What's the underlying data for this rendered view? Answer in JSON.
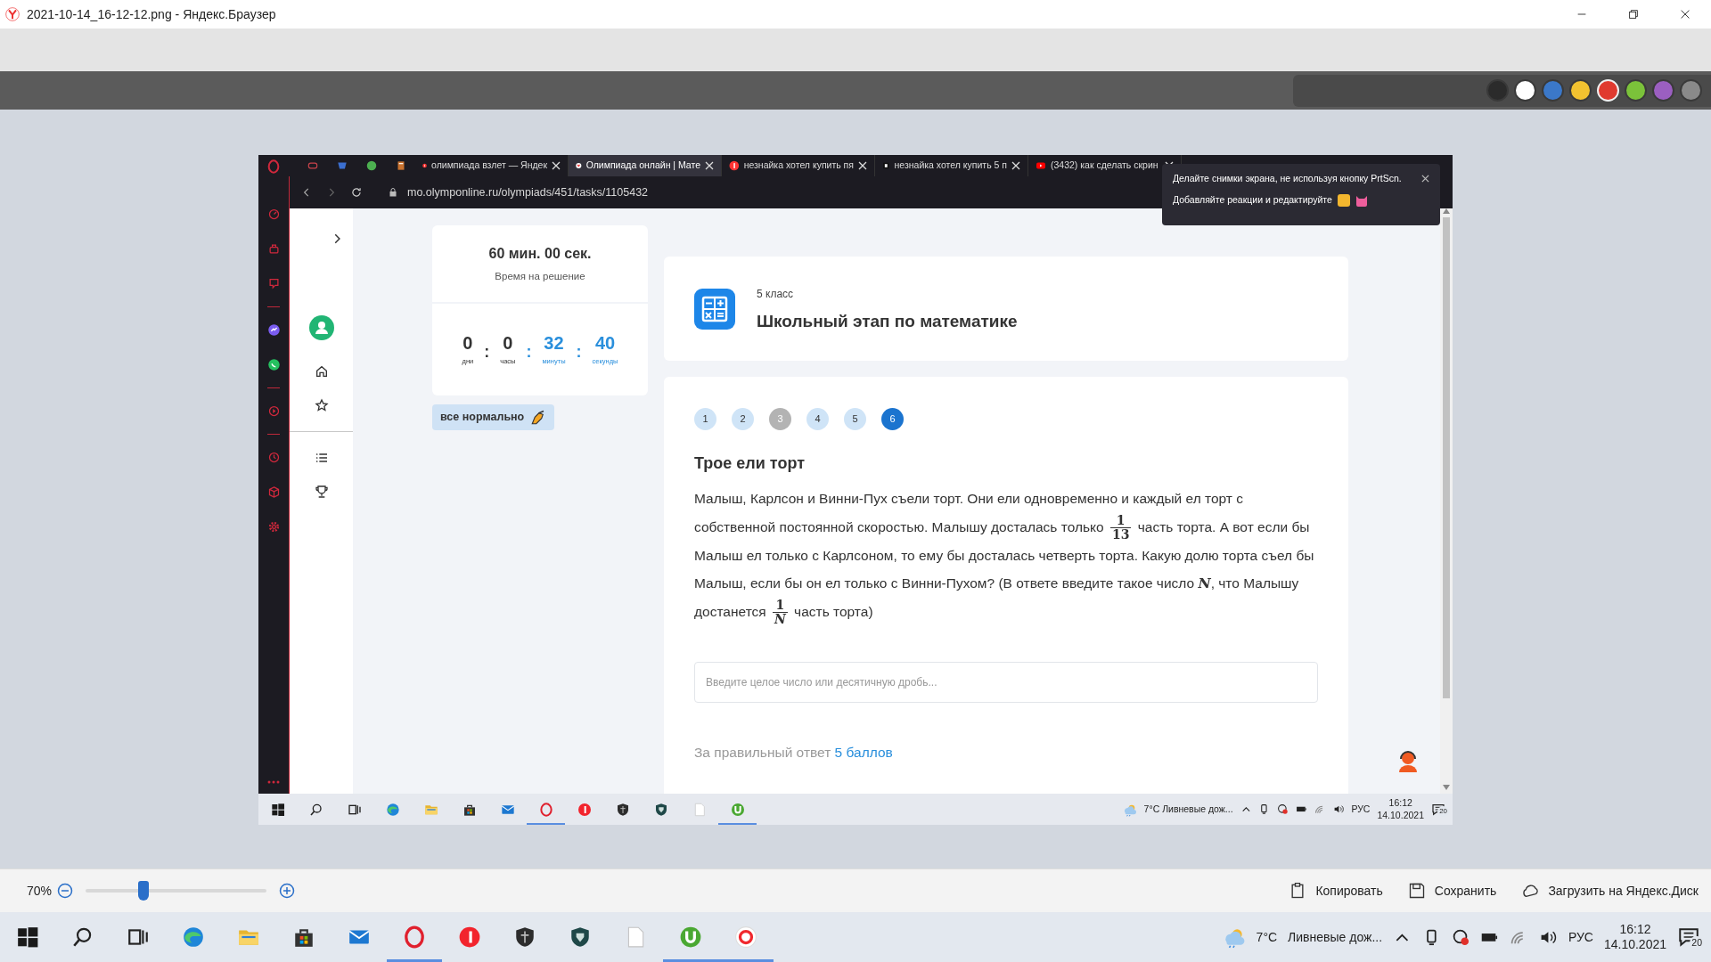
{
  "window": {
    "title": "2021-10-14_16-12-12.png - Яндекс.Браузер"
  },
  "palette": [
    {
      "color": "#2b2b2b",
      "selected": false
    },
    {
      "color": "#ffffff",
      "selected": false
    },
    {
      "color": "#3b78c9",
      "selected": false
    },
    {
      "color": "#f2c230",
      "selected": false
    },
    {
      "color": "#e03a2f",
      "selected": true
    },
    {
      "color": "#7bc23a",
      "selected": false
    },
    {
      "color": "#9b5fc0",
      "selected": false
    },
    {
      "color": "#8a8a8a",
      "selected": false
    }
  ],
  "screenshot": {
    "tabs": [
      {
        "kind": "yandex",
        "label": "олимпиада взлет — Яндек",
        "selected": false
      },
      {
        "kind": "site",
        "label": "Олимпиада онлайн | Мате",
        "selected": true
      },
      {
        "kind": "yandex",
        "label": "незнайка хотел купить пя",
        "selected": false
      },
      {
        "kind": "digit",
        "label": "незнайка хотел купить 5 п",
        "selected": false
      },
      {
        "kind": "video",
        "label": "(3432) как сделать скрин",
        "selected": false
      }
    ],
    "address": "mo.olymponline.ru/olympiads/451/tasks/1105432",
    "notification": {
      "line_1": "Делайте снимки экрана, не используя кнопку PrtScn.",
      "line_2": "Добавляйте реакции и редактируйте"
    },
    "timer": {
      "duration": "60 мин. 00 сек.",
      "caption": "Время на решение",
      "separator": ":",
      "units": [
        {
          "value": "0",
          "label": "дни",
          "highlight": false
        },
        {
          "value": "0",
          "label": "часы",
          "highlight": false
        },
        {
          "value": "32",
          "label": "минуты",
          "highlight": true
        },
        {
          "value": "40",
          "label": "секунды",
          "highlight": true
        }
      ]
    },
    "mood_button": "все нормально",
    "header": {
      "grade": "5 класс",
      "title": "Школьный этап по математике"
    },
    "steps": [
      {
        "label": "1",
        "skipped": false,
        "selected": false
      },
      {
        "label": "2",
        "skipped": false,
        "selected": false
      },
      {
        "label": "3",
        "skipped": true,
        "selected": false
      },
      {
        "label": "4",
        "skipped": false,
        "selected": false
      },
      {
        "label": "5",
        "skipped": false,
        "selected": false
      },
      {
        "label": "6",
        "skipped": false,
        "selected": true
      }
    ],
    "task": {
      "title": "Трое ели торт",
      "text": [
        {
          "kind": "text",
          "text": "Малыш, Карлсон и Винни-Пух съели торт. Они ели одновременно и каждый ел торт с собственной постоянной скоростью. Малышу досталась только "
        },
        {
          "kind": "fraction",
          "numerator": "1",
          "denominator": "13",
          "variable": false
        },
        {
          "kind": "text",
          "text": " часть торта. А вот если бы Малыш ел только с Карлсоном, то ему бы досталась четверть торта. Какую долю торта съел бы Малыш, если бы он ел только с Винни-Пухом? (В ответе введите такое число "
        },
        {
          "kind": "variable",
          "text": "N"
        },
        {
          "kind": "text",
          "text": ", что Малышу достанется "
        },
        {
          "kind": "fraction",
          "numerator": "1",
          "denominator": "N",
          "variable": true
        },
        {
          "kind": "text",
          "text": " часть торта)"
        }
      ]
    },
    "answer": {
      "placeholder": "Введите целое число или десятичную дробь..."
    },
    "score": {
      "label": "За правильный ответ",
      "value": "5 баллов"
    },
    "taskbar": {
      "apps": [
        {
          "kind": "start",
          "running": false
        },
        {
          "kind": "search",
          "running": false
        },
        {
          "kind": "taskview",
          "running": false
        },
        {
          "kind": "edge",
          "running": false
        },
        {
          "kind": "folder",
          "running": false
        },
        {
          "kind": "store",
          "running": false
        },
        {
          "kind": "mail",
          "running": false
        },
        {
          "kind": "opera",
          "running": true
        },
        {
          "kind": "yandex",
          "running": false
        },
        {
          "kind": "tanks",
          "running": false
        },
        {
          "kind": "ships",
          "running": false
        },
        {
          "kind": "file",
          "running": false
        },
        {
          "kind": "torrent",
          "running": true
        }
      ],
      "weather": "7°C Ливневые дож...",
      "language": "РУС",
      "time": "16:12",
      "date": "14.10.2021",
      "notifications": "20"
    }
  },
  "viewer": {
    "zoom": "70%",
    "level": 0.32,
    "actions": [
      "Копировать",
      "Сохранить",
      "Загрузить на Яндекс.Диск"
    ]
  },
  "taskbar": {
    "apps": [
      {
        "kind": "start",
        "running": false
      },
      {
        "kind": "search",
        "running": false
      },
      {
        "kind": "taskview",
        "running": false
      },
      {
        "kind": "edge",
        "running": false
      },
      {
        "kind": "folder",
        "running": false
      },
      {
        "kind": "store",
        "running": false
      },
      {
        "kind": "mail",
        "running": false
      },
      {
        "kind": "opera",
        "running": true
      },
      {
        "kind": "yandex",
        "running": false
      },
      {
        "kind": "tanks",
        "running": false
      },
      {
        "kind": "ships",
        "running": false
      },
      {
        "kind": "file",
        "running": false
      },
      {
        "kind": "torrent",
        "running": true
      },
      {
        "kind": "browser",
        "running": true
      }
    ],
    "temperature": "7°C",
    "weather": "Ливневые дож...",
    "language": "РУС",
    "time": "16:12",
    "date": "14.10.2021",
    "notifications": "20"
  }
}
